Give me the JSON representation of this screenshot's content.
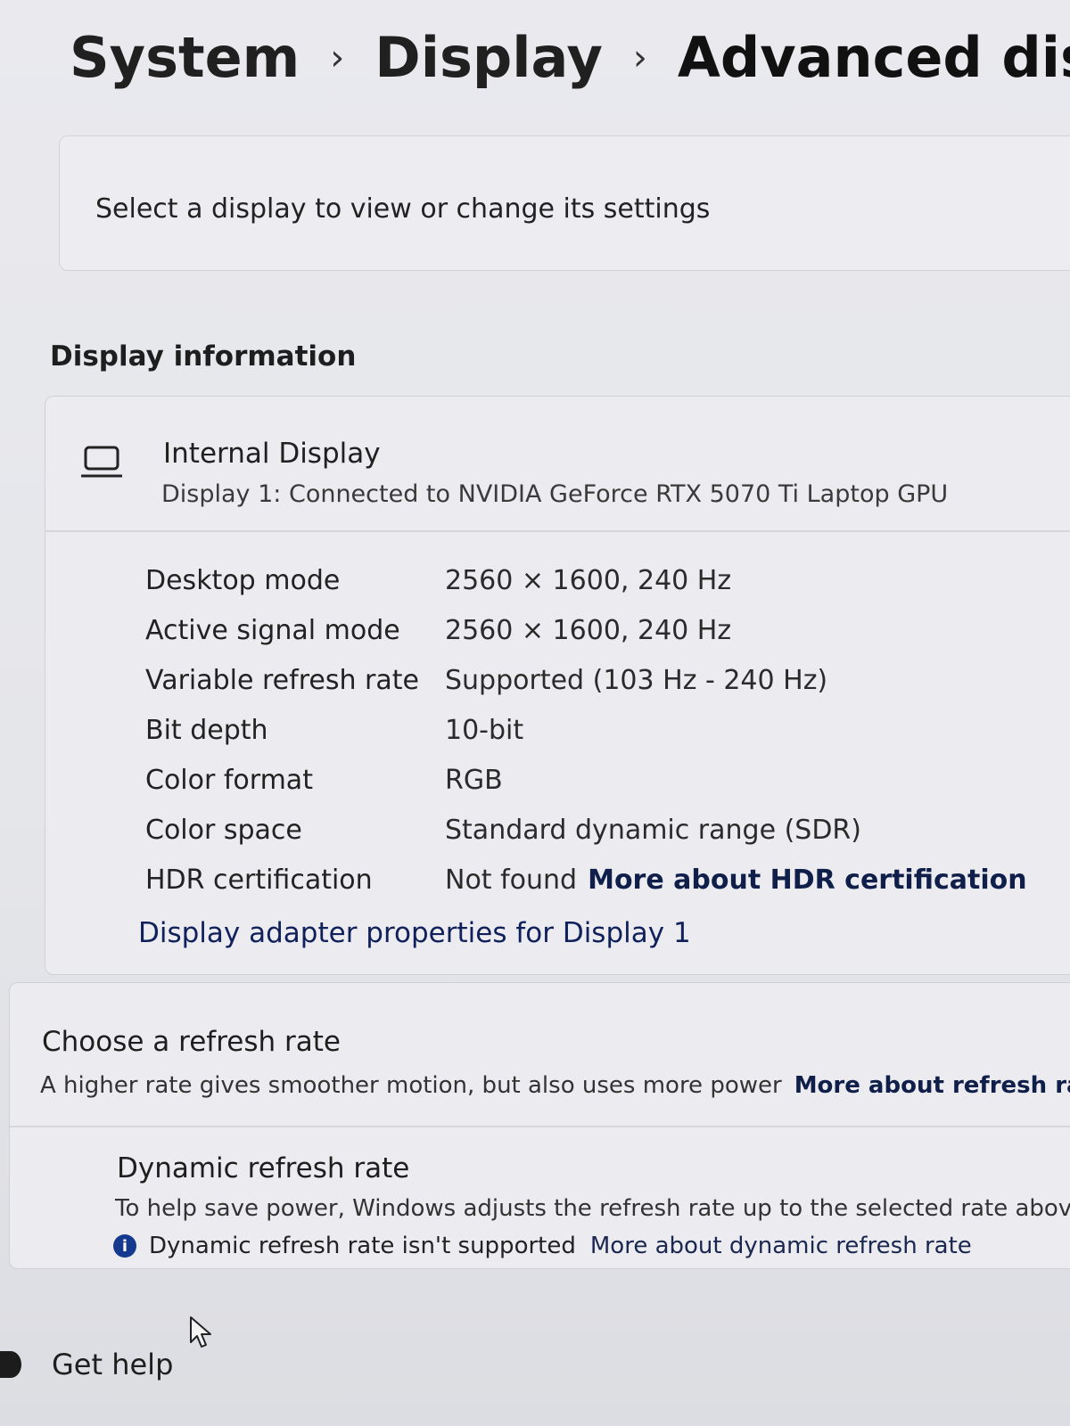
{
  "breadcrumb": {
    "system": "System",
    "display": "Display",
    "current": "Advanced display",
    "separator": "›"
  },
  "select_display": {
    "text": "Select a display to view or change its settings"
  },
  "display_information": {
    "heading": "Display information",
    "display_name": "Internal Display",
    "display_subtitle": "Display 1: Connected to NVIDIA GeForce RTX 5070 Ti Laptop GPU",
    "icon": "laptop-icon",
    "properties": [
      {
        "label": "Desktop mode",
        "value": "2560 × 1600, 240 Hz"
      },
      {
        "label": "Active signal mode",
        "value": "2560 × 1600, 240 Hz"
      },
      {
        "label": "Variable refresh rate",
        "value": "Supported (103 Hz - 240 Hz)"
      },
      {
        "label": "Bit depth",
        "value": "10-bit"
      },
      {
        "label": "Color format",
        "value": "RGB"
      },
      {
        "label": "Color space",
        "value": "Standard dynamic range (SDR)"
      },
      {
        "label": "HDR certification",
        "value": "Not found",
        "link": "More about HDR certification"
      }
    ],
    "adapter_link": "Display adapter properties for Display 1"
  },
  "refresh_rate": {
    "title": "Choose a refresh rate",
    "description": "A higher rate gives smoother motion, but also uses more power",
    "link": "More about refresh rate",
    "dynamic_title": "Dynamic refresh rate",
    "dynamic_description": "To help save power, Windows adjusts the refresh rate up to the selected rate above",
    "dynamic_note_icon": "info-icon",
    "dynamic_note_icon_glyph": "i",
    "dynamic_note": "Dynamic refresh rate isn't supported",
    "dynamic_link": "More about dynamic refresh rate"
  },
  "footer": {
    "help_label": "Get help",
    "help_icon": "help-icon"
  },
  "colors": {
    "link": "#0f1f4a",
    "info_accent": "#15398f",
    "background": "#e7e8ec"
  }
}
